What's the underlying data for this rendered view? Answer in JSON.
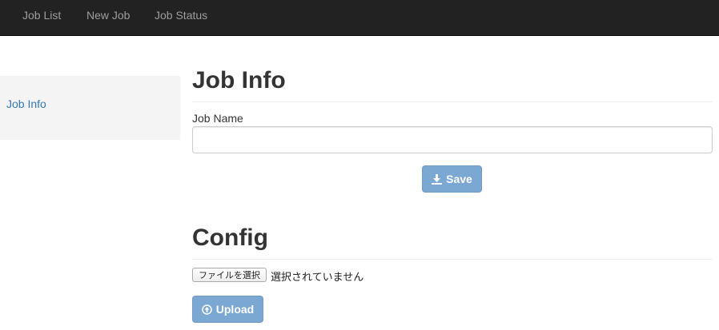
{
  "nav": {
    "items": [
      {
        "label": "Job List"
      },
      {
        "label": "New Job"
      },
      {
        "label": "Job Status"
      }
    ]
  },
  "sidebar": {
    "items": [
      {
        "label": "Job Info"
      }
    ]
  },
  "job_info": {
    "title": "Job Info",
    "job_name_label": "Job Name",
    "job_name_value": "",
    "save_label": "Save"
  },
  "config": {
    "title": "Config",
    "file_button_label": "ファイルを選択",
    "file_status": "選択されていません",
    "upload_label": "Upload"
  },
  "colors": {
    "navbar_bg": "#222222",
    "nav_text": "#9d9d9d",
    "link": "#337ab7",
    "button_bg": "#7aa8d2"
  }
}
